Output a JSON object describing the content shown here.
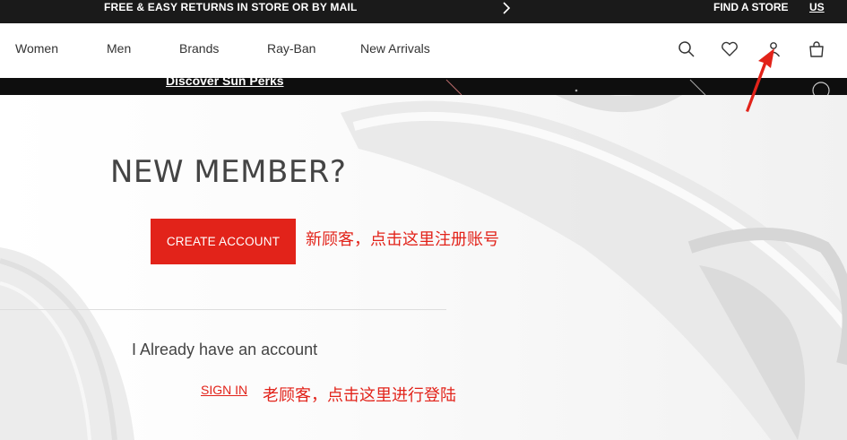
{
  "promo": {
    "message": "FREE & EASY RETURNS IN STORE OR BY MAIL",
    "find_store": "FIND A STORE",
    "locale": "US"
  },
  "nav": {
    "items": [
      {
        "label": "Women"
      },
      {
        "label": "Men"
      },
      {
        "label": "Brands"
      },
      {
        "label": "Ray-Ban"
      },
      {
        "label": "New Arrivals"
      }
    ],
    "icons": [
      "search-icon",
      "heart-icon",
      "account-icon",
      "bag-icon"
    ]
  },
  "perks": {
    "link": "Discover Sun Perks"
  },
  "main": {
    "new_member_title": "NEW MEMBER?",
    "create_account_label": "CREATE ACCOUNT",
    "annotation_new": "新顾客，点击这里注册账号",
    "already_account": "I Already have an account",
    "sign_in_label": "SIGN IN",
    "annotation_old": "老顾客，点击这里进行登陆"
  },
  "colors": {
    "accent": "#e2231a",
    "top_bar": "#1a1a1a",
    "annotation": "#e2231a"
  }
}
